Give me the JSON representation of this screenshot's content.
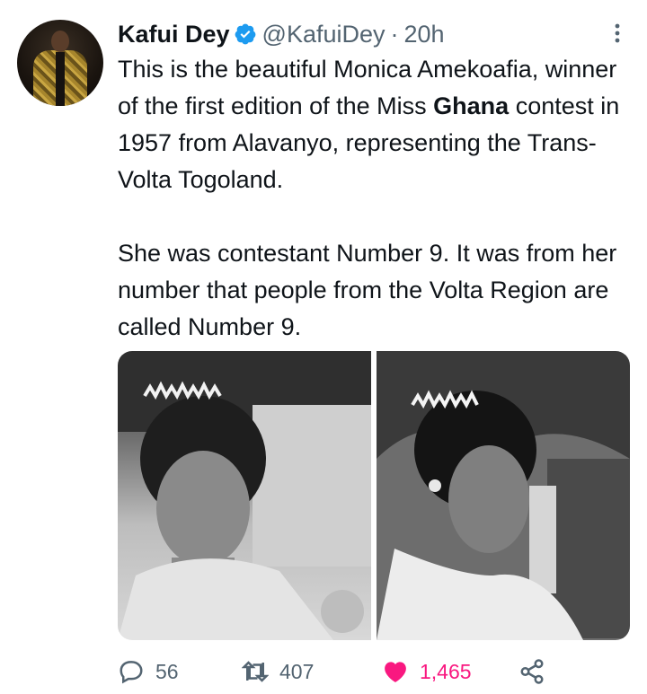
{
  "tweet": {
    "author_name": "Kafui Dey",
    "author_handle": "@KafuiDey",
    "separator": "·",
    "time": "20h",
    "text_line1_pre": "This is the beautiful Monica Amekoafia, winner of the first edition of the Miss ",
    "text_bold": "Ghana",
    "text_line1_post": " contest in 1957 from Alavanyo, representing the Trans-Volta Togoland.",
    "text_para2": "She was contestant Number 9. It was from her number that people from the Volta Region are called Number 9."
  },
  "actions": {
    "reply_count": "56",
    "retweet_count": "407",
    "like_count": "1,465"
  },
  "colors": {
    "text": "#0f1419",
    "secondary": "#536471",
    "verified": "#1d9bf0",
    "like": "#f91880"
  },
  "icons": [
    "verified-badge-icon",
    "more-icon",
    "reply-icon",
    "retweet-icon",
    "heart-icon",
    "share-icon"
  ]
}
